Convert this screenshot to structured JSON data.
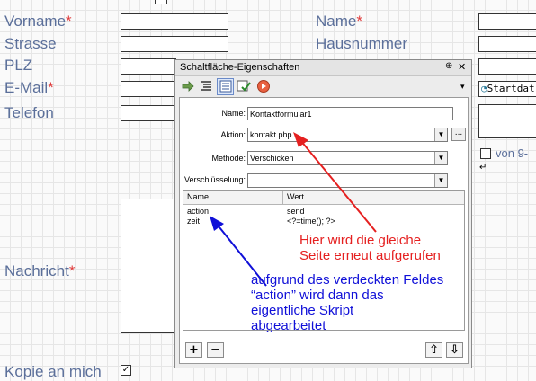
{
  "form": {
    "vorname": "Vorname",
    "name": "Name",
    "strasse": "Strasse",
    "hausnummer": "Hausnummer",
    "plz": "PLZ",
    "email": "E-Mail",
    "telefon": "Telefon",
    "nachricht": "Nachricht",
    "kopie": "Kopie an mich",
    "required_marker": "*",
    "date_partial": "Startdat",
    "von_partial": "von 9-",
    "kopie_checked": "✓"
  },
  "panel": {
    "title": "Schaltfläche-Eigenschaften",
    "pin": "⊕",
    "close": "✕",
    "menu_arrow": "▾",
    "name_label": "Name:",
    "name_value": "Kontaktformular1",
    "aktion_label": "Aktion:",
    "aktion_value": "kontakt.php",
    "browse_label": "...",
    "methode_label": "Methode:",
    "methode_value": "Verschicken",
    "verschl_label": "Verschlüsselung:",
    "verschl_value": "",
    "col_name": "Name",
    "col_wert": "Wert",
    "rows": [
      {
        "name": "action",
        "wert": "send"
      },
      {
        "name": "zeit",
        "wert": "<?=time(); ?>"
      }
    ],
    "add": "+",
    "remove": "−",
    "up": "⇧",
    "down": "⇩"
  },
  "annotations": {
    "red_line1": "Hier wird die gleiche",
    "red_line2": "Seite erneut aufgerufen",
    "blue_line1": "aufgrund des verdeckten Feldes",
    "blue_line2": "“action” wird dann das",
    "blue_line3": "eigentliche Skript",
    "blue_line4": "abgearbeitet",
    "red_color": "#e52020",
    "blue_color": "#1010d8"
  }
}
